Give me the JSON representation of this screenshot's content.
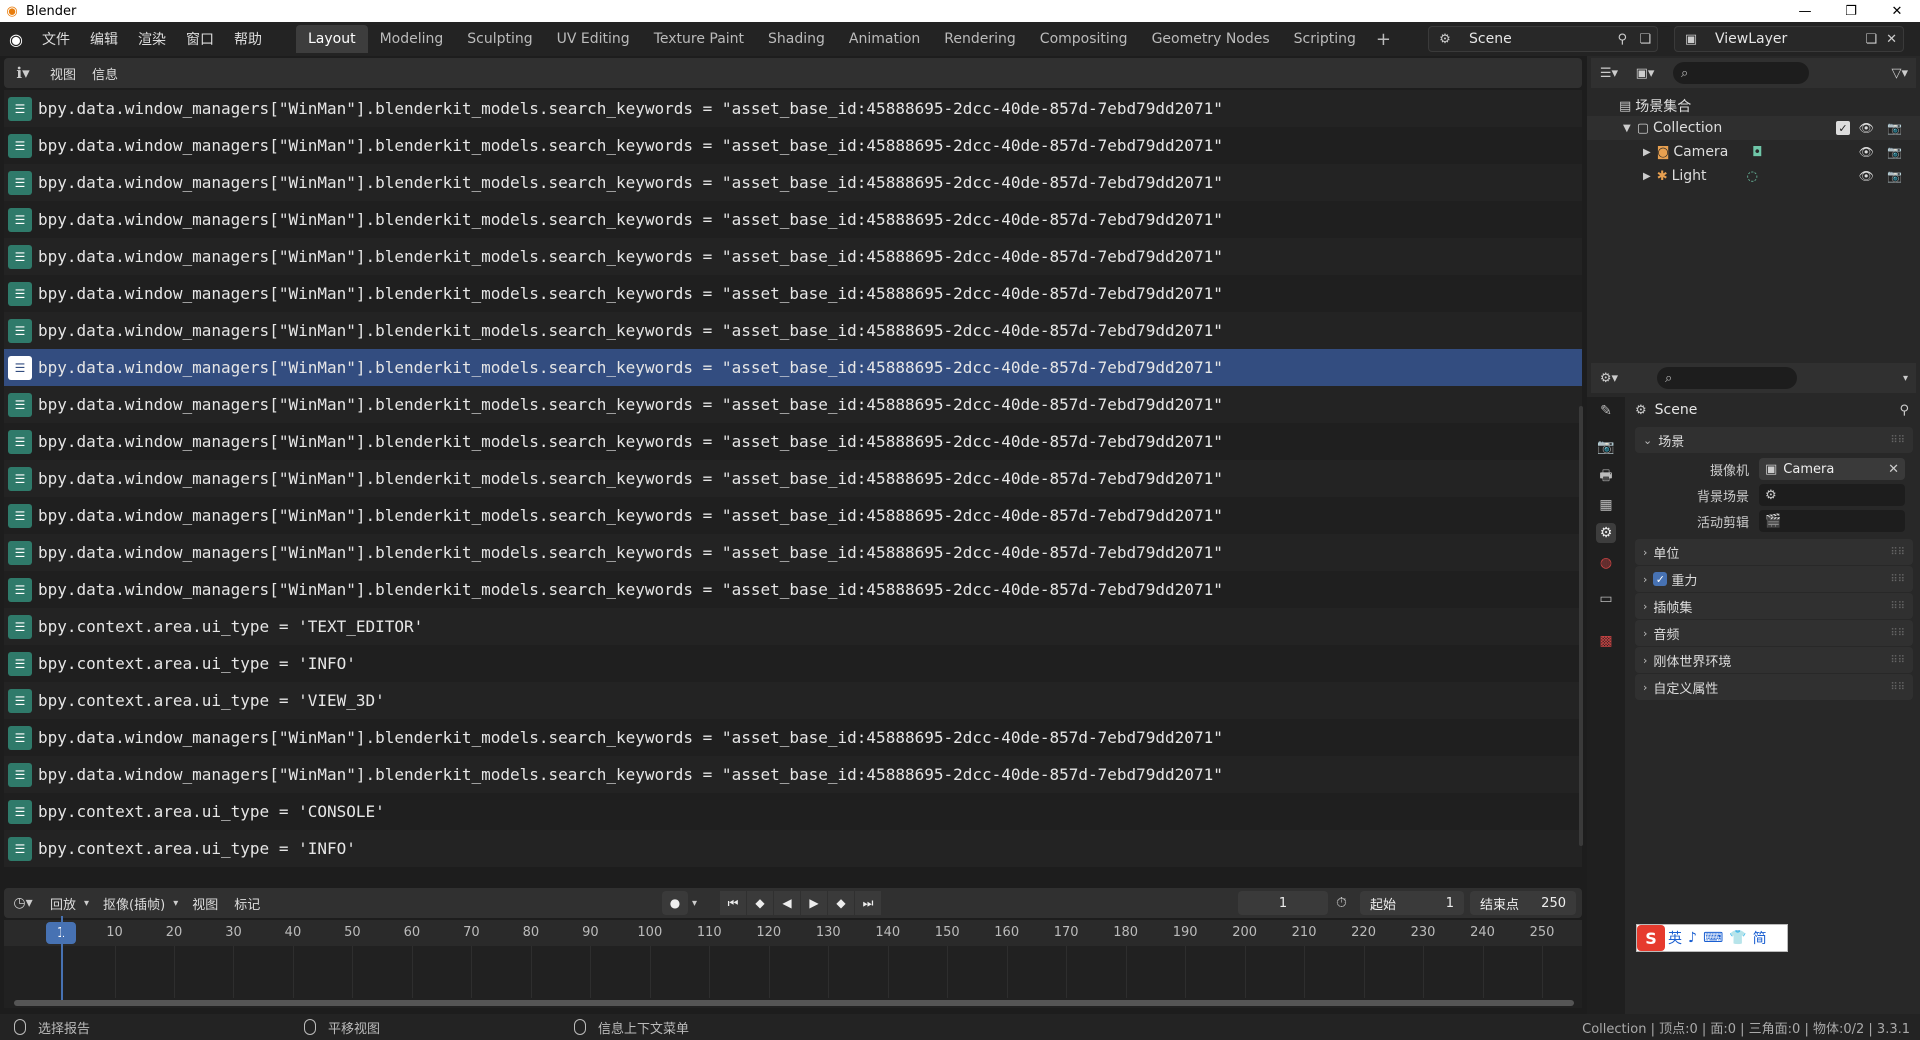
{
  "window": {
    "title": "Blender"
  },
  "menu": [
    "文件",
    "编辑",
    "渲染",
    "窗口",
    "帮助"
  ],
  "workspace_tabs": [
    {
      "label": "Layout",
      "active": true
    },
    {
      "label": "Modeling"
    },
    {
      "label": "Sculpting"
    },
    {
      "label": "UV Editing"
    },
    {
      "label": "Texture Paint"
    },
    {
      "label": "Shading"
    },
    {
      "label": "Animation"
    },
    {
      "label": "Rendering"
    },
    {
      "label": "Compositing"
    },
    {
      "label": "Geometry Nodes"
    },
    {
      "label": "Scripting"
    }
  ],
  "scene_selector": {
    "value": "Scene"
  },
  "viewlayer_selector": {
    "value": "ViewLayer"
  },
  "info_editor": {
    "header_menu": [
      "视图",
      "信息"
    ],
    "selected_index": 7,
    "lines": [
      "bpy.data.window_managers[\"WinMan\"].blenderkit_models.search_keywords = \"asset_base_id:45888695-2dcc-40de-857d-7ebd79dd2071\"",
      "bpy.data.window_managers[\"WinMan\"].blenderkit_models.search_keywords = \"asset_base_id:45888695-2dcc-40de-857d-7ebd79dd2071\"",
      "bpy.data.window_managers[\"WinMan\"].blenderkit_models.search_keywords = \"asset_base_id:45888695-2dcc-40de-857d-7ebd79dd2071\"",
      "bpy.data.window_managers[\"WinMan\"].blenderkit_models.search_keywords = \"asset_base_id:45888695-2dcc-40de-857d-7ebd79dd2071\"",
      "bpy.data.window_managers[\"WinMan\"].blenderkit_models.search_keywords = \"asset_base_id:45888695-2dcc-40de-857d-7ebd79dd2071\"",
      "bpy.data.window_managers[\"WinMan\"].blenderkit_models.search_keywords = \"asset_base_id:45888695-2dcc-40de-857d-7ebd79dd2071\"",
      "bpy.data.window_managers[\"WinMan\"].blenderkit_models.search_keywords = \"asset_base_id:45888695-2dcc-40de-857d-7ebd79dd2071\"",
      "bpy.data.window_managers[\"WinMan\"].blenderkit_models.search_keywords = \"asset_base_id:45888695-2dcc-40de-857d-7ebd79dd2071\"",
      "bpy.data.window_managers[\"WinMan\"].blenderkit_models.search_keywords = \"asset_base_id:45888695-2dcc-40de-857d-7ebd79dd2071\"",
      "bpy.data.window_managers[\"WinMan\"].blenderkit_models.search_keywords = \"asset_base_id:45888695-2dcc-40de-857d-7ebd79dd2071\"",
      "bpy.data.window_managers[\"WinMan\"].blenderkit_models.search_keywords = \"asset_base_id:45888695-2dcc-40de-857d-7ebd79dd2071\"",
      "bpy.data.window_managers[\"WinMan\"].blenderkit_models.search_keywords = \"asset_base_id:45888695-2dcc-40de-857d-7ebd79dd2071\"",
      "bpy.data.window_managers[\"WinMan\"].blenderkit_models.search_keywords = \"asset_base_id:45888695-2dcc-40de-857d-7ebd79dd2071\"",
      "bpy.data.window_managers[\"WinMan\"].blenderkit_models.search_keywords = \"asset_base_id:45888695-2dcc-40de-857d-7ebd79dd2071\"",
      "bpy.context.area.ui_type = 'TEXT_EDITOR'",
      "bpy.context.area.ui_type = 'INFO'",
      "bpy.context.area.ui_type = 'VIEW_3D'",
      "bpy.data.window_managers[\"WinMan\"].blenderkit_models.search_keywords = \"asset_base_id:45888695-2dcc-40de-857d-7ebd79dd2071\"",
      "bpy.data.window_managers[\"WinMan\"].blenderkit_models.search_keywords = \"asset_base_id:45888695-2dcc-40de-857d-7ebd79dd2071\"",
      "bpy.context.area.ui_type = 'CONSOLE'",
      "bpy.context.area.ui_type = 'INFO'"
    ]
  },
  "timeline": {
    "menu": [
      "回放",
      "抠像(插帧)",
      "视图",
      "标记"
    ],
    "current_frame": "1",
    "start_label": "起始",
    "start_value": "1",
    "end_label": "结束点",
    "end_value": "250",
    "ruler_current": "1",
    "ruler_ticks": [
      "10",
      "20",
      "30",
      "40",
      "50",
      "60",
      "70",
      "80",
      "90",
      "100",
      "110",
      "120",
      "130",
      "140",
      "150",
      "160",
      "170",
      "180",
      "190",
      "200",
      "210",
      "220",
      "230",
      "240",
      "250"
    ]
  },
  "outliner": {
    "root": "场景集合",
    "collection": "Collection",
    "items": [
      {
        "label": "Camera",
        "icon": "camera-object-icon"
      },
      {
        "label": "Light",
        "icon": "light-object-icon"
      }
    ]
  },
  "properties": {
    "context_title": "Scene",
    "scene_panel": "场景",
    "camera_label": "摄像机",
    "camera_value": "Camera",
    "background_label": "背景场景",
    "clip_label": "活动剪辑",
    "panels": [
      "单位",
      "重力",
      "插帧集",
      "音频",
      "刚体世界环境",
      "自定义属性"
    ],
    "gravity_checked": true
  },
  "status_bar": {
    "left": "选择报告",
    "middle": "平移视图",
    "right_ctx": "信息上下文菜单",
    "stats": "Collection | 顶点:0 | 面:0 | 三角面:0 | 物体:0/2 | 3.3.1"
  },
  "ime_toolbar": {
    "logo": "S",
    "items": [
      "英",
      "♪",
      "⌨",
      "👕",
      "简"
    ]
  },
  "colors": {
    "accent": "#4772b3",
    "selection_row": "#334d80",
    "info_icon": "#2f7a6a"
  }
}
